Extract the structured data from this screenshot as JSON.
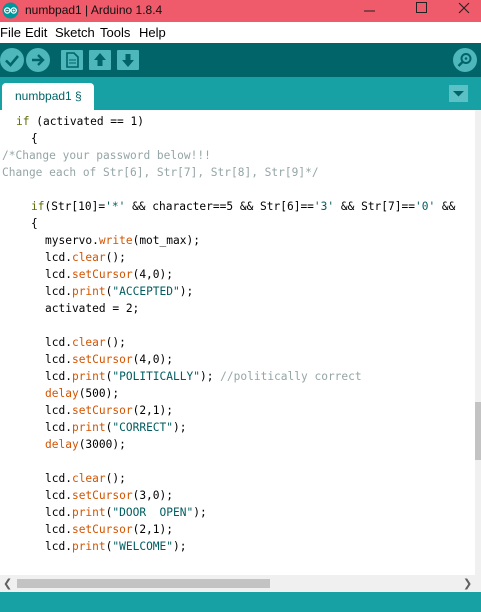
{
  "window": {
    "title": "numbpad1 | Arduino 1.8.4",
    "app_icon": "arduino-logo-icon",
    "controls": [
      "minimize-icon",
      "maximize-icon",
      "close-icon"
    ]
  },
  "menu": {
    "items": [
      "File",
      "Edit",
      "Sketch",
      "Tools",
      "Help"
    ]
  },
  "toolbar": {
    "buttons": [
      "verify-icon",
      "upload-icon",
      "new-icon",
      "open-icon",
      "save-icon"
    ],
    "serial_monitor": "serial-monitor-icon"
  },
  "tabs": [
    {
      "label": "numbpad1 §",
      "active": true
    }
  ],
  "colors": {
    "titlebar": "#ef5b6a",
    "toolbar": "#006468",
    "tab_strip": "#17a1a5",
    "keyword": "#5e6d03",
    "function": "#d35400",
    "string": "#005c5f",
    "comment": "#95a5a6"
  },
  "code_lines": [
    [
      [
        "kw",
        "if"
      ],
      [
        "p",
        " (activated == 1)"
      ]
    ],
    [
      [
        "p",
        "{"
      ]
    ],
    [
      [
        "c",
        "/*Change your password below!!!"
      ]
    ],
    [
      [
        "c",
        "Change each of Str[6], Str[7], Str[8], Str[9]*/"
      ]
    ],
    [],
    [
      [
        "kw",
        "if"
      ],
      [
        "p",
        "(Str[10]="
      ],
      [
        "s",
        "'*'"
      ],
      [
        "p",
        " && character==5 && Str[6]=="
      ],
      [
        "s",
        "'3'"
      ],
      [
        "p",
        " && Str[7]=="
      ],
      [
        "s",
        "'0'"
      ],
      [
        "p",
        " &&"
      ]
    ],
    [
      [
        "p",
        "{"
      ]
    ],
    [
      [
        "p",
        "myservo."
      ],
      [
        "f",
        "write"
      ],
      [
        "p",
        "(mot_max);"
      ]
    ],
    [
      [
        "p",
        "lcd."
      ],
      [
        "f",
        "clear"
      ],
      [
        "p",
        "();"
      ]
    ],
    [
      [
        "p",
        "lcd."
      ],
      [
        "f",
        "setCursor"
      ],
      [
        "p",
        "(4,0);"
      ]
    ],
    [
      [
        "p",
        "lcd."
      ],
      [
        "f",
        "print"
      ],
      [
        "p",
        "("
      ],
      [
        "s",
        "\"ACCEPTED\""
      ],
      [
        "p",
        ");"
      ]
    ],
    [
      [
        "p",
        "activated = 2;"
      ]
    ],
    [],
    [
      [
        "p",
        "lcd."
      ],
      [
        "f",
        "clear"
      ],
      [
        "p",
        "();"
      ]
    ],
    [
      [
        "p",
        "lcd."
      ],
      [
        "f",
        "setCursor"
      ],
      [
        "p",
        "(4,0);"
      ]
    ],
    [
      [
        "p",
        "lcd."
      ],
      [
        "f",
        "print"
      ],
      [
        "p",
        "("
      ],
      [
        "s",
        "\"POLITICALLY\""
      ],
      [
        "p",
        "); "
      ],
      [
        "c",
        "//politically correct"
      ]
    ],
    [
      [
        "f",
        "delay"
      ],
      [
        "p",
        "(500);"
      ]
    ],
    [
      [
        "p",
        "lcd."
      ],
      [
        "f",
        "setCursor"
      ],
      [
        "p",
        "(2,1);"
      ]
    ],
    [
      [
        "p",
        "lcd."
      ],
      [
        "f",
        "print"
      ],
      [
        "p",
        "("
      ],
      [
        "s",
        "\"CORRECT\""
      ],
      [
        "p",
        ");"
      ]
    ],
    [
      [
        "f",
        "delay"
      ],
      [
        "p",
        "(3000);"
      ]
    ],
    [],
    [
      [
        "p",
        "lcd."
      ],
      [
        "f",
        "clear"
      ],
      [
        "p",
        "();"
      ]
    ],
    [
      [
        "p",
        "lcd."
      ],
      [
        "f",
        "setCursor"
      ],
      [
        "p",
        "(3,0);"
      ]
    ],
    [
      [
        "p",
        "lcd."
      ],
      [
        "f",
        "print"
      ],
      [
        "p",
        "("
      ],
      [
        "s",
        "\"DOOR  OPEN\""
      ],
      [
        "p",
        ");"
      ]
    ],
    [
      [
        "p",
        "lcd."
      ],
      [
        "f",
        "setCursor"
      ],
      [
        "p",
        "(2,1);"
      ]
    ],
    [
      [
        "p",
        "lcd."
      ],
      [
        "f",
        "print"
      ],
      [
        "p",
        "("
      ],
      [
        "s",
        "\"WELCOME\""
      ],
      [
        "p",
        ");"
      ]
    ]
  ],
  "scrollbars": {
    "horizontal_left": "scroll-left-icon",
    "horizontal_right": "scroll-right-icon"
  }
}
